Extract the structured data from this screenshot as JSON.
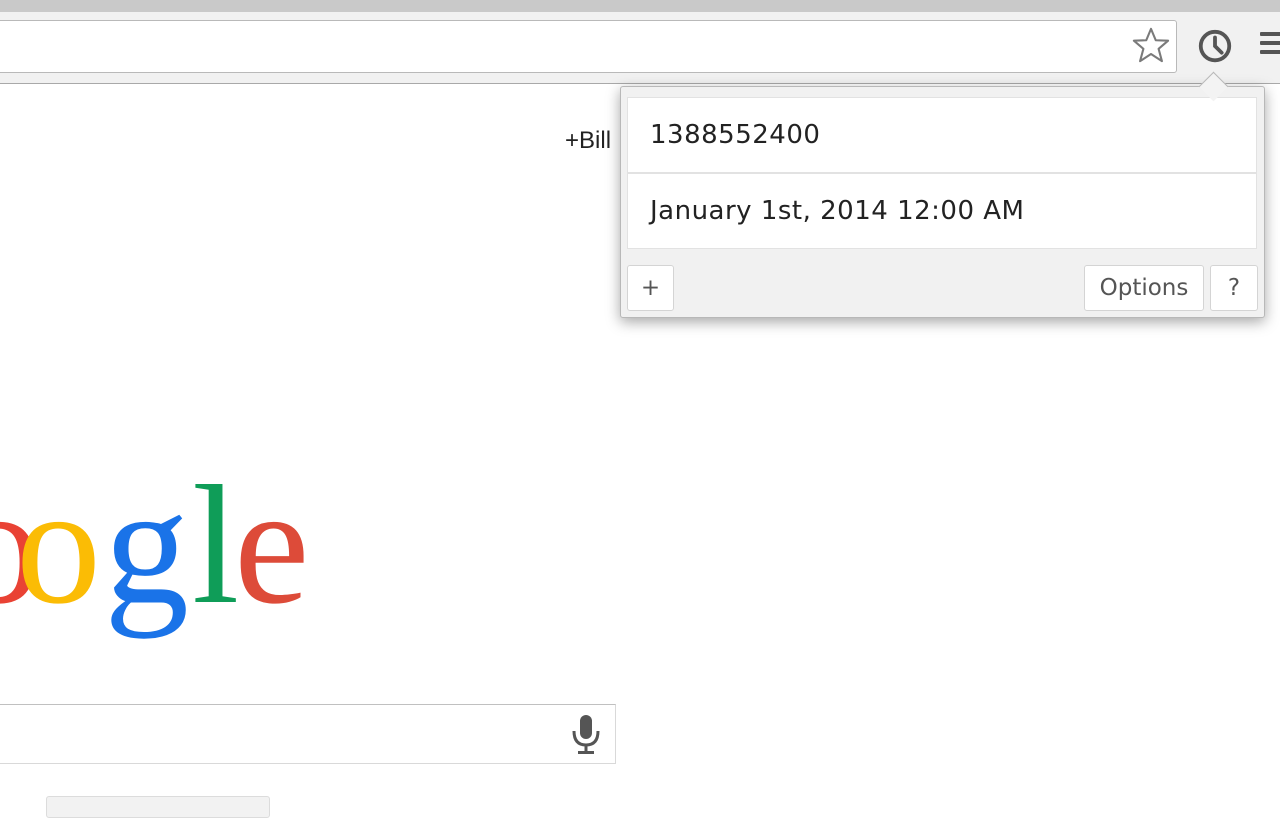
{
  "browser": {
    "omnibox_value": "",
    "star_icon": "star-icon",
    "extension_icon": "clock-icon",
    "menu_icon": "hamburger-menu-icon"
  },
  "page": {
    "account_link": "+Bill",
    "logo_letters": [
      "o",
      "o",
      "g",
      "l",
      "e"
    ],
    "logo_colors": [
      "#e94234",
      "#fbbc05",
      "#1a73e8",
      "#0f9d58",
      "#dd4b39"
    ],
    "search_value": "",
    "mic_icon": "microphone-icon"
  },
  "popup": {
    "timestamp_value": "1388552400",
    "date_value": "January 1st, 2014 12:00 AM",
    "add_label": "+",
    "options_label": "Options",
    "help_label": "?"
  }
}
